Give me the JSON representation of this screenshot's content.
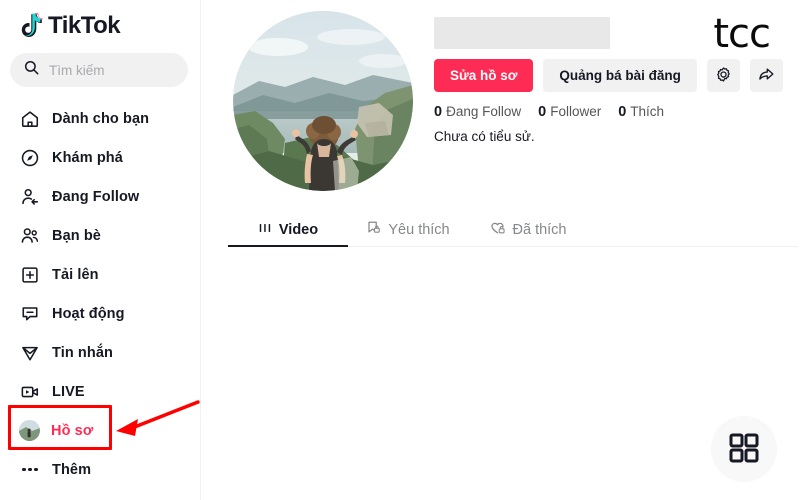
{
  "brand": {
    "logo_text": "TikTok",
    "logo_icon": "tiktok-note-icon",
    "watermark": "tcc"
  },
  "search": {
    "placeholder": "Tìm kiếm",
    "value": "",
    "icon": "search-icon"
  },
  "sidebar": {
    "items": [
      {
        "label": "Dành cho bạn",
        "icon": "home-icon",
        "active": false
      },
      {
        "label": "Khám phá",
        "icon": "compass-icon",
        "active": false
      },
      {
        "label": "Đang Follow",
        "icon": "user-follow-icon",
        "active": false
      },
      {
        "label": "Bạn bè",
        "icon": "friends-icon",
        "active": false
      },
      {
        "label": "Tải lên",
        "icon": "plus-box-icon",
        "active": false
      },
      {
        "label": "Hoạt động",
        "icon": "activity-icon",
        "active": false
      },
      {
        "label": "Tin nhắn",
        "icon": "send-icon",
        "active": false
      },
      {
        "label": "LIVE",
        "icon": "live-video-icon",
        "active": false
      },
      {
        "label": "Hồ sơ",
        "icon": "profile-avatar-icon",
        "active": true
      },
      {
        "label": "Thêm",
        "icon": "more-dots-icon",
        "active": false
      }
    ]
  },
  "profile": {
    "avatar_icon": "landscape-photo-avatar",
    "username_redacted": true,
    "bio": "Chưa có tiểu sử.",
    "buttons": {
      "edit": "Sửa hồ sơ",
      "promote": "Quảng bá bài đăng",
      "settings_icon": "gear-icon",
      "share_icon": "share-arrow-icon"
    },
    "stats": [
      {
        "count": "0",
        "label": "Đang Follow"
      },
      {
        "count": "0",
        "label": "Follower"
      },
      {
        "count": "0",
        "label": "Thích"
      }
    ]
  },
  "tabs": [
    {
      "label": "Video",
      "icon": "grid-bars-icon",
      "active": true
    },
    {
      "label": "Yêu thích",
      "icon": "bookmark-lock-icon",
      "active": false
    },
    {
      "label": "Đã thích",
      "icon": "heart-lock-icon",
      "active": false
    }
  ],
  "fab": {
    "icon": "qr-grid-icon",
    "label": ""
  },
  "annotation": {
    "color": "#ff0000",
    "target": "Hồ sơ",
    "shapes": [
      "highlight-rectangle",
      "pointer-arrow"
    ]
  }
}
